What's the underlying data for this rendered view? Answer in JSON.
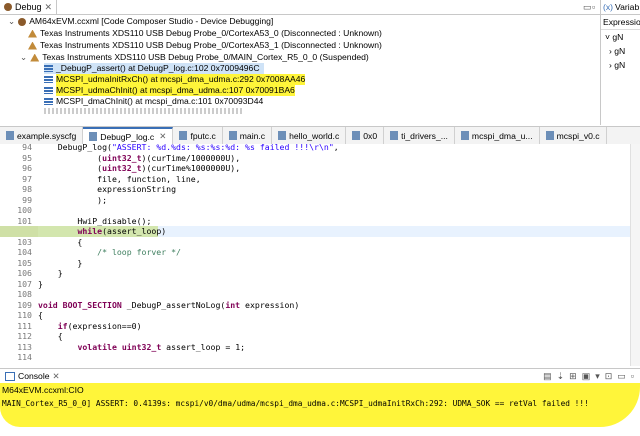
{
  "debug": {
    "tab_label": "Debug",
    "session": "AM64xEVM.ccxml [Code Composer Studio - Device Debugging]",
    "probes": [
      "Texas Instruments XDS110 USB Debug Probe_0/CortexA53_0 (Disconnected : Unknown)",
      "Texas Instruments XDS110 USB Debug Probe_0/CortexA53_1 (Disconnected : Unknown)",
      "Texas Instruments XDS110 USB Debug Probe_0/MAIN_Cortex_R5_0_0 (Suspended)"
    ],
    "frames": [
      "_DebugP_assert() at DebugP_log.c:102 0x7009496C",
      "MCSPI_udmaInitRxCh() at mcspi_dma_udma.c:292 0x7008AA46",
      "MCSPI_udmaChInit() at mcspi_dma_udma.c:107 0x70091BA6",
      "MCSPI_dmaChInit() at mcspi_dma.c:101 0x70093D44"
    ]
  },
  "variables": {
    "tab_label": "Variab",
    "expr_label": "Expression",
    "rows": [
      "gN",
      "gN",
      "gN"
    ]
  },
  "editor_tabs": [
    {
      "label": "example.syscfg",
      "active": false
    },
    {
      "label": "DebugP_log.c",
      "active": true
    },
    {
      "label": "fputc.c",
      "active": false
    },
    {
      "label": "main.c",
      "active": false
    },
    {
      "label": "hello_world.c",
      "active": false
    },
    {
      "label": "0x0",
      "active": false
    },
    {
      "label": "ti_drivers_...",
      "active": false
    },
    {
      "label": "mcspi_dma_u...",
      "active": false
    },
    {
      "label": "mcspi_v0.c",
      "active": false
    }
  ],
  "code_lines": [
    {
      "n": "94",
      "text": "    DebugP_log(\"ASSERT: %d.%ds: %s:%s:%d: %s failed !!!\\r\\n\","
    },
    {
      "n": "95",
      "text": "            (uint32_t)(curTime/1000000U),"
    },
    {
      "n": "96",
      "text": "            (uint32_t)(curTime%1000000U),"
    },
    {
      "n": "97",
      "text": "            file, function, line,"
    },
    {
      "n": "98",
      "text": "            expressionString"
    },
    {
      "n": "99",
      "text": "            );"
    },
    {
      "n": "100",
      "text": ""
    },
    {
      "n": "101",
      "text": "        HwiP_disable();"
    },
    {
      "n": "102",
      "text": "        while(assert_loop)"
    },
    {
      "n": "103",
      "text": "        {"
    },
    {
      "n": "104",
      "text": "            /* loop forver */"
    },
    {
      "n": "105",
      "text": "        }"
    },
    {
      "n": "106",
      "text": "    }"
    },
    {
      "n": "107",
      "text": "}"
    },
    {
      "n": "108",
      "text": ""
    },
    {
      "n": "109",
      "text": "void BOOT_SECTION _DebugP_assertNoLog(int expression)"
    },
    {
      "n": "110",
      "text": "{"
    },
    {
      "n": "111",
      "text": "    if(expression==0)"
    },
    {
      "n": "112",
      "text": "    {"
    },
    {
      "n": "113",
      "text": "        volatile uint32_t assert_loop = 1;"
    },
    {
      "n": "114",
      "text": ""
    }
  ],
  "console": {
    "tab_label": "Console",
    "source": "M64xEVM.ccxml:CIO",
    "message": "MAIN_Cortex_R5_0_0] ASSERT: 0.4139s: mcspi/v0/dma/udma/mcspi_dma_udma.c:MCSPI_udmaInitRxCh:292: UDMA_SOK == retVal failed !!!"
  },
  "colors": {
    "highlight": "#fff53a",
    "current_line": "#d3e6ae",
    "keyword": "#7f0055",
    "string": "#2a00ff",
    "comment": "#3f7f5f"
  }
}
